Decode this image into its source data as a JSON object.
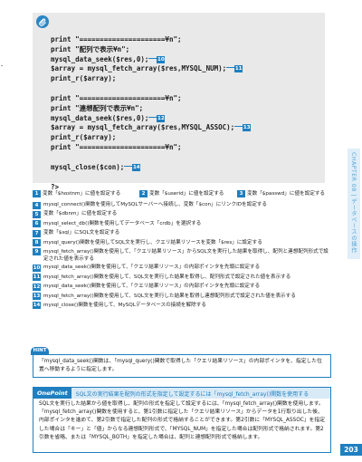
{
  "code_lines": [
    "print \"=====================¥n\";",
    "print \"配列で表示¥n\";",
    "mysql_data_seek($res,0);",
    "$array = mysql_fetch_array($res,MYSQL_NUM);",
    "print_r($array);",
    "",
    "print \"=====================¥n\";",
    "print \"連想配列で表示¥n\";",
    "mysql_data_seek($res,0);",
    "$array = mysql_fetch_array($res,MYSQL_ASSOC);",
    "print_r($array);",
    "print \"=====================¥n\";",
    "",
    "mysql_close($con);",
    "",
    "?>"
  ],
  "code_badges": {
    "l3": "10",
    "l4": "11",
    "l9": "12",
    "l10": "13",
    "l14": "14"
  },
  "legend_top": [
    {
      "num": "1",
      "text": "変数「$hostnm」に値を設定する"
    },
    {
      "num": "2",
      "text": "変数「$userid」に値を設定する"
    },
    {
      "num": "3",
      "text": "変数「$passwd」に値を設定する"
    }
  ],
  "steps": [
    {
      "num": "4",
      "text": "mysql_connect()関数を使用してMySQLサーバーへ接続し、変数「$con」にリンクIDを設定する"
    },
    {
      "num": "5",
      "text": "変数「$dbnm」に値を設定する"
    },
    {
      "num": "6",
      "text": "mysql_select_db()関数を使用してデータベース「crdb」を選択する"
    },
    {
      "num": "7",
      "text": "変数「$sql」にSQL文を設定する"
    },
    {
      "num": "8",
      "text": "mysql_query()関数を使用してSQL文を実行し、クエリ結果リソースを変数「$res」に設定する"
    },
    {
      "num": "9",
      "text": "mysql_fetch_array()関数を使用して、「クエリ結果リソース」からSQL文を実行した結果を取得し、配列と連想配列形式で設定された値を表示する"
    },
    {
      "num": "10",
      "text": "mysql_data_seek()関数を使用して、「クエリ結果リソース」の内部ポインタを先頭に設定する"
    },
    {
      "num": "11",
      "text": "mysql_fetch_array()関数を使用して、SQL文を実行した結果を取得し、配列形式で設定された値を表示する"
    },
    {
      "num": "12",
      "text": "mysql_data_seek()関数を使用して、「クエリ結果リソース」の内部ポインタを先頭に設定する"
    },
    {
      "num": "13",
      "text": "mysql_fetch_array()関数を使用して、SQL文を実行した結果を取得し連想配列形式で設定された値を表示する"
    },
    {
      "num": "14",
      "text": "mysql_close()関数を使用して、MySQLデータベースの接続を解除する"
    }
  ],
  "hint": {
    "label": "HINT",
    "text": "「mysql_data_seek()関数は、「mysql_query()関数で取得した「クエリ結果リソース」の内部ポインタを、指定した位置へ移動するように指定します。"
  },
  "onepoint": {
    "badge": "OnePoint",
    "title": "SQL文の実行結果を配列の形式を指定して設定するには「mysql_fetch_array()関数を使用する",
    "body": "SQL文を実行した結果から値を取得し、配列の形式を指定して設定するには、「mysql_fetch_array()関数を使用します。「mysql_fetch_array()関数を使用すると、第1引数に指定した「クエリ結果リソース」からデータを1行取り出した後、内部ポインタを進めて、第2引数で指定した配列の形式で格納することができます。第2引数に「MYSQL_ASSOC」を指定した場合は「キー」と「値」からなる連想配列形式で、「MYSQL_NUM」を指定した場合は配列形式で格納されます。第2引数を省略、または「MYSQL_BOTH」を指定した場合は、配列と連想配列形式で格納します。"
  },
  "side_tab": {
    "text": "CHAPTER 08 | データベースの操作"
  },
  "page_number": "203",
  "colors": {
    "accent": "#1f7fc0",
    "code_bg": "#e9e9e9",
    "tab_bg": "#dfeef8"
  }
}
